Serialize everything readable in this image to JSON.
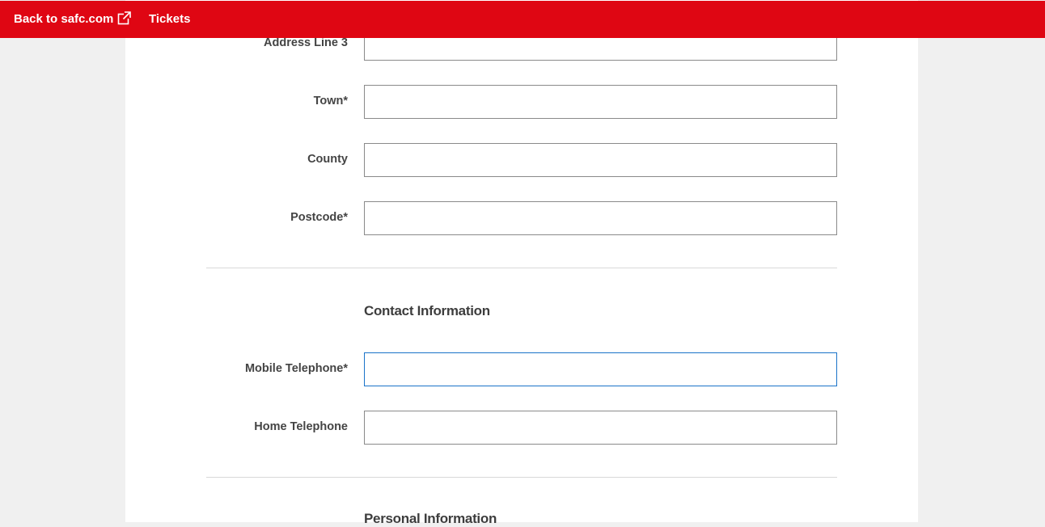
{
  "header": {
    "back_label": "Back to safc.com",
    "tickets_label": "Tickets",
    "background_color": "#df0613"
  },
  "address": {
    "line3_label": "Address Line 3",
    "town_label": "Town*",
    "county_label": "County",
    "postcode_label": "Postcode*"
  },
  "contact": {
    "heading": "Contact Information",
    "mobile_label": "Mobile Telephone*",
    "home_label": "Home Telephone"
  },
  "personal": {
    "heading": "Personal Information"
  },
  "colors": {
    "focus_border": "#1a73c9",
    "page_background": "#f0f0f0"
  },
  "icons": {
    "external_link": "external-link-icon"
  }
}
